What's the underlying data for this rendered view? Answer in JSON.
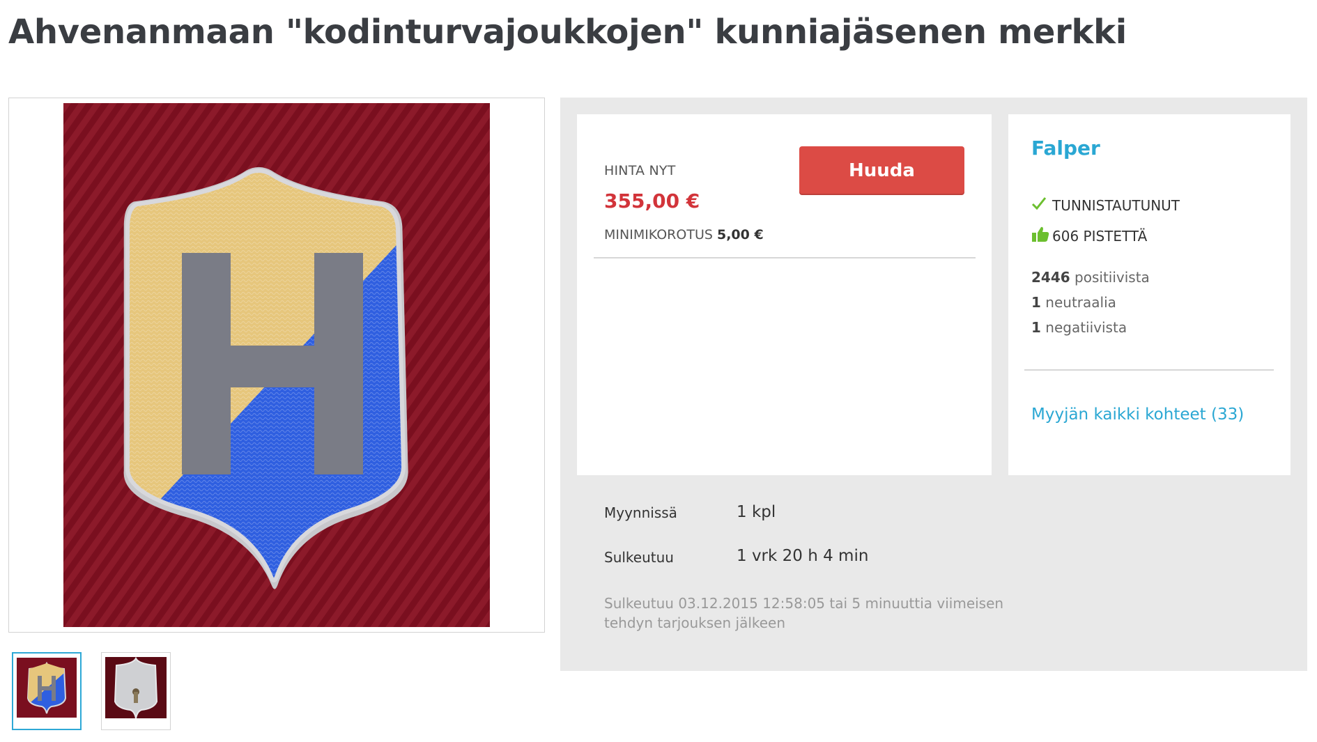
{
  "page": {
    "title": "Ahvenanmaan \"kodinturvajoukkojen\" kunniajäsenen merkki"
  },
  "gallery": {
    "main_image_alt": "Emaloitu kilpimerkki, H-kirjain, keltainen ja sininen",
    "thumbnails": [
      {
        "alt": "Merkin etupuoli"
      },
      {
        "alt": "Merkin takapuoli"
      }
    ]
  },
  "bid": {
    "price_label": "HINTA NYT",
    "price_value": "355,00 €",
    "min_raise_label": "MINIMIKOROTUS",
    "min_raise_value": "5,00 €",
    "button_label": "Huuda",
    "colors": {
      "price": "#d2343a",
      "button": "#dc4b45"
    }
  },
  "seller": {
    "name": "Falper",
    "verified_label": "TUNNISTAUTUNUT",
    "points_label": "606 PISTETTÄ",
    "feedback": [
      {
        "count": "2446",
        "label": "positiivista"
      },
      {
        "count": "1",
        "label": "neutraalia"
      },
      {
        "count": "1",
        "label": "negatiivista"
      }
    ],
    "all_items_link": "Myyjän kaikki kohteet (33)",
    "icons": {
      "verified": "check-icon",
      "points": "thumbs-up-icon"
    },
    "colors": {
      "link": "#2aa7d3",
      "icon": "#6cbf2f"
    }
  },
  "details": {
    "for_sale_label": "Myynnissä",
    "for_sale_value": "1 kpl",
    "closes_label": "Sulkeutuu",
    "closes_value": "1 vrk 20 h 4 min",
    "close_note": "Sulkeutuu 03.12.2015 12:58:05 tai 5 minuuttia viimeisen tehdyn tarjouksen jälkeen"
  }
}
